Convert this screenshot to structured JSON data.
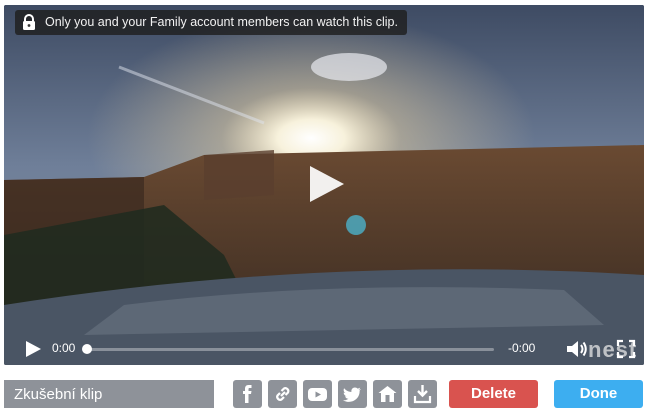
{
  "player": {
    "privacy_notice": "Only you and your Family account members can watch this clip.",
    "current_time": "0:00",
    "duration": "-0:00",
    "watermark": "nest",
    "progress_fraction": 0
  },
  "clip": {
    "title": "Zkušební klip"
  },
  "share_icons": [
    "facebook-icon",
    "link-icon",
    "youtube-icon",
    "twitter-icon",
    "home-icon",
    "download-icon"
  ],
  "actions": {
    "delete_label": "Delete",
    "done_label": "Done"
  },
  "colors": {
    "delete": "#d9534f",
    "done": "#3daef0",
    "icon_button": "#8e9299"
  }
}
